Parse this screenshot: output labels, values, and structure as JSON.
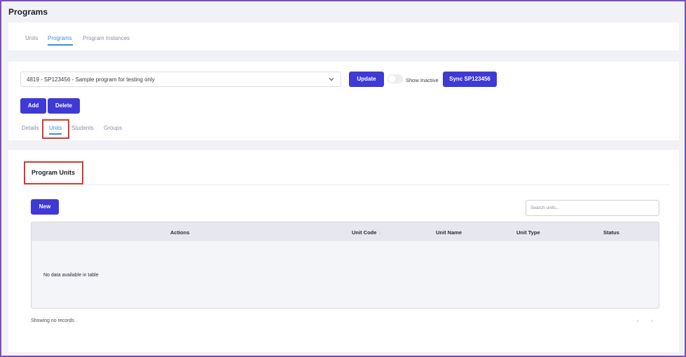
{
  "page": {
    "title": "Programs"
  },
  "top_tabs": [
    {
      "label": "Units",
      "active": false
    },
    {
      "label": "Programs",
      "active": true
    },
    {
      "label": "Program Instances",
      "active": false
    }
  ],
  "program_select": {
    "value": "4819 - SP123456 - Sample program for testing only"
  },
  "toolbar": {
    "update_label": "Update",
    "show_inactive_label": "Show Inactive",
    "show_inactive_on": false,
    "sync_label": "Sync SP123456",
    "add_label": "Add",
    "delete_label": "Delete"
  },
  "detail_tabs": [
    {
      "label": "Details",
      "active": false
    },
    {
      "label": "Units",
      "active": true
    },
    {
      "label": "Students",
      "active": false
    },
    {
      "label": "Groups",
      "active": false
    }
  ],
  "program_units": {
    "title": "Program Units",
    "new_label": "New",
    "search_placeholder": "Search units...",
    "columns": [
      "Actions",
      "Unit Code",
      "Unit Name",
      "Unit Type",
      "Status"
    ],
    "sort_indicator": "↓",
    "empty_message": "No data available in table",
    "footer": "Showing no records",
    "pager_prev": "‹",
    "pager_next": "›"
  },
  "colors": {
    "primary": "#3f39d6",
    "active_tab": "#3e8ee0",
    "highlight_border": "#d43a2f"
  }
}
